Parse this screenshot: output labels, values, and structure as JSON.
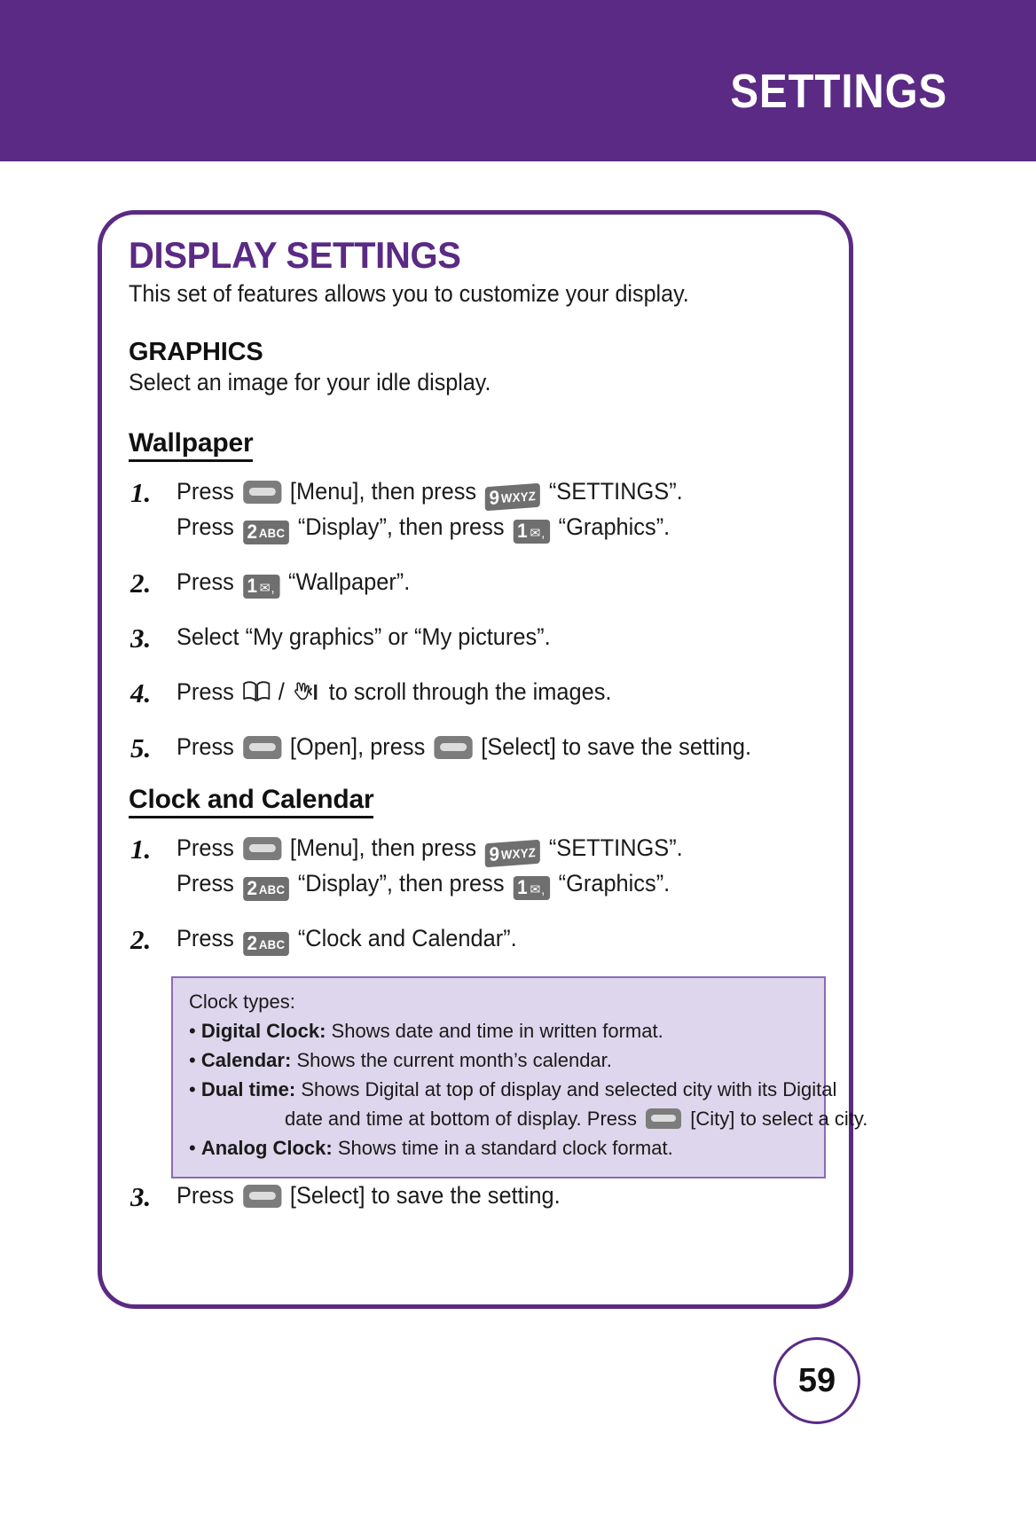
{
  "header": {
    "title": "SETTINGS",
    "band_color": "#5a2a84"
  },
  "card": {
    "title": "DISPLAY SETTINGS",
    "intro": "This set of features allows you to customize your display.",
    "section_heading": "GRAPHICS",
    "section_sub": "Select an image for your idle display.",
    "subsections": [
      {
        "heading": "Wallpaper",
        "steps": [
          {
            "num": "1.",
            "lines": [
              {
                "parts": [
                  "Press ",
                  "[SOFTKEY]",
                  " [Menu], then press ",
                  "[KEY9]",
                  " “SETTINGS”."
                ]
              },
              {
                "parts": [
                  "Press ",
                  "[KEY2]",
                  " “Display”, then press ",
                  "[KEY1]",
                  " “Graphics”."
                ]
              }
            ],
            "text_line_1_a": "Press",
            "text_line_1_b": "[Menu], then press",
            "text_line_1_c": "“SETTINGS”.",
            "text_line_2_a": "Press",
            "text_line_2_b": "“Display”, then press",
            "text_line_2_c": "“Graphics”."
          },
          {
            "num": "2.",
            "text_a": "Press",
            "text_b": "“Wallpaper”."
          },
          {
            "num": "3.",
            "text_a": "Select “My graphics” or “My pictures”."
          },
          {
            "num": "4.",
            "text_a": "Press",
            "text_sep": "/",
            "text_b": "to scroll through the images."
          },
          {
            "num": "5.",
            "text_a": "Press",
            "text_b": "[Open], press",
            "text_c": "[Select] to save the setting."
          }
        ]
      },
      {
        "heading": "Clock and Calendar",
        "steps": [
          {
            "num": "1.",
            "text_line_1_a": "Press",
            "text_line_1_b": "[Menu], then press",
            "text_line_1_c": "“SETTINGS”.",
            "text_line_2_a": "Press",
            "text_line_2_b": "“Display”, then press",
            "text_line_2_c": "“Graphics”."
          },
          {
            "num": "2.",
            "text_a": "Press",
            "text_b": "“Clock and Calendar”."
          },
          {
            "num": "3.",
            "text_a": "Press",
            "text_b": "[Select] to save the setting."
          }
        ]
      }
    ],
    "notebox": {
      "title": "Clock types:",
      "border_color": "#8a6bb5",
      "fill_color": "#ddd6ec",
      "items": [
        {
          "bullet": "•",
          "term": "Digital Clock:",
          "desc": "Shows date and time in written format."
        },
        {
          "bullet": "•",
          "term": "Calendar:",
          "desc": "Shows the current month’s calendar."
        },
        {
          "bullet": "•",
          "term": "Dual time:",
          "desc": "Shows Digital at top of display and selected city with its Digital",
          "cont_a": "date and time at bottom of display. Press",
          "cont_b": "[City] to select a city."
        },
        {
          "bullet": "•",
          "term": "Analog Clock:",
          "desc": "Shows time in a standard clock format."
        }
      ]
    }
  },
  "keys": {
    "softkey": "soft-key",
    "key9_digit": "9",
    "key9_letters": "WXYZ",
    "key2_digit": "2",
    "key2_letters": "ABC",
    "key1_digit": "1",
    "key1_env": "✉",
    "key1_comma": ","
  },
  "page_number": "59"
}
